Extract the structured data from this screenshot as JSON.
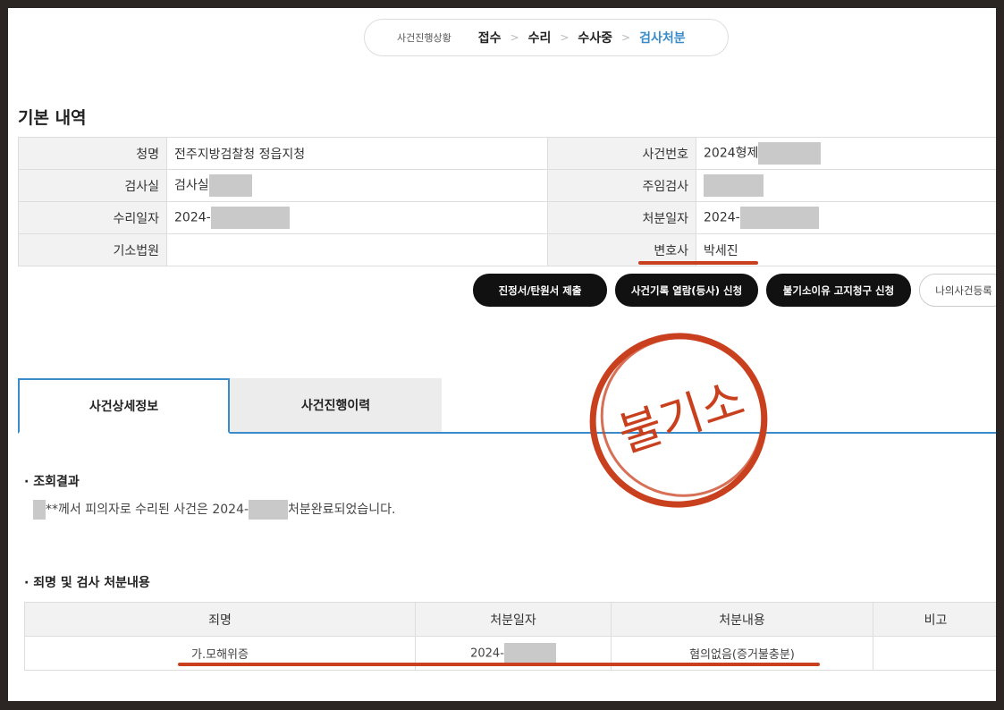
{
  "progress": {
    "label": "사건진행상황",
    "steps": [
      "접수",
      "수리",
      "수사중",
      "검사처분"
    ],
    "separator": ">"
  },
  "basic": {
    "title": "기본 내역",
    "rows": [
      {
        "l_label": "청명",
        "l_value": "전주지방검찰청 정읍지청",
        "r_label": "사건번호",
        "r_value": "2024형제"
      },
      {
        "l_label": "검사실",
        "l_value": "검사실",
        "r_label": "주임검사",
        "r_value": ""
      },
      {
        "l_label": "수리일자",
        "l_value": "2024-",
        "r_label": "처분일자",
        "r_value": "2024-"
      },
      {
        "l_label": "기소법원",
        "l_value": "",
        "r_label": "변호사",
        "r_value": "박세진"
      }
    ]
  },
  "buttons": {
    "submit": "진정서/탄원서 제출",
    "view": "사건기록 열람(등사) 신청",
    "notice": "불기소이유 고지청구 신청",
    "register": "나의사건등록"
  },
  "tabs": {
    "detail": "사건상세정보",
    "history": "사건진행이력"
  },
  "result": {
    "title": "· 조회결과",
    "text_1": "**께서 피의자로 수리된 사건은 2024-",
    "text_2": "처분완료되었습니다."
  },
  "disposition": {
    "title": "· 죄명 및 검사 처분내용",
    "headers": [
      "죄명",
      "처분일자",
      "처분내용",
      "비고"
    ],
    "row": {
      "crime": "가.모해위증",
      "date": "2024-",
      "content": "혐의없음(증거불충분)",
      "note": ""
    }
  },
  "stamp": {
    "text": "불기소",
    "color": "#c9401f"
  }
}
